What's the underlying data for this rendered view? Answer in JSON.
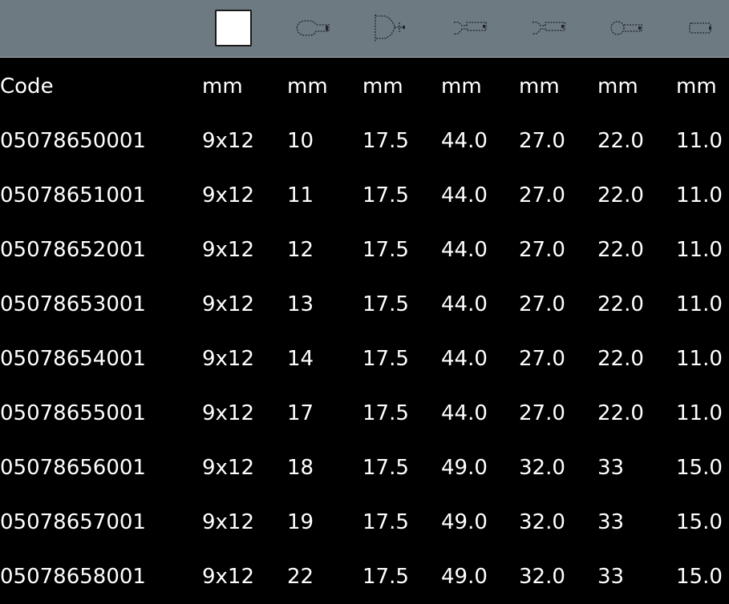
{
  "header_icons": [
    "blank-square-icon",
    "open-end-wrench-icon",
    "socket-profile-icon",
    "open-jaw-head-icon",
    "open-jaw-head-icon",
    "ring-head-icon",
    "handle-end-icon"
  ],
  "table": {
    "headers": [
      "Code",
      "mm",
      "mm",
      "mm",
      "mm",
      "mm",
      "mm",
      "mm"
    ],
    "rows": [
      [
        "05078650001",
        "9x12",
        "10",
        "17.5",
        "44.0",
        "27.0",
        "22.0",
        "11.0"
      ],
      [
        "05078651001",
        "9x12",
        "11",
        "17.5",
        "44.0",
        "27.0",
        "22.0",
        "11.0"
      ],
      [
        "05078652001",
        "9x12",
        "12",
        "17.5",
        "44.0",
        "27.0",
        "22.0",
        "11.0"
      ],
      [
        "05078653001",
        "9x12",
        "13",
        "17.5",
        "44.0",
        "27.0",
        "22.0",
        "11.0"
      ],
      [
        "05078654001",
        "9x12",
        "14",
        "17.5",
        "44.0",
        "27.0",
        "22.0",
        "11.0"
      ],
      [
        "05078655001",
        "9x12",
        "17",
        "17.5",
        "44.0",
        "27.0",
        "22.0",
        "11.0"
      ],
      [
        "05078656001",
        "9x12",
        "18",
        "17.5",
        "49.0",
        "32.0",
        "33",
        "15.0"
      ],
      [
        "05078657001",
        "9x12",
        "19",
        "17.5",
        "49.0",
        "32.0",
        "33",
        "15.0"
      ],
      [
        "05078658001",
        "9x12",
        "22",
        "17.5",
        "49.0",
        "32.0",
        "33",
        "15.0"
      ]
    ]
  }
}
